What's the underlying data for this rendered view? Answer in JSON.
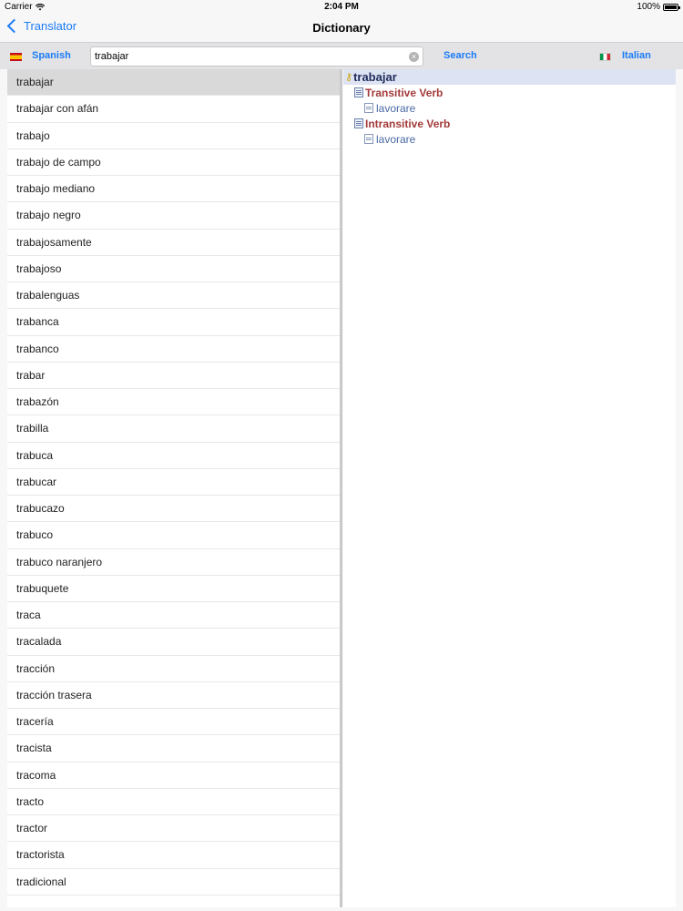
{
  "status_bar": {
    "carrier": "Carrier",
    "time": "2:04 PM",
    "battery": "100%"
  },
  "nav": {
    "back_label": "Translator",
    "title": "Dictionary"
  },
  "toolbar": {
    "source_language": "Spanish",
    "target_language": "Italian",
    "search_value": "trabajar",
    "search_button": "Search"
  },
  "word_list": [
    "trabajar",
    "trabajar con afán",
    "trabajo",
    "trabajo de campo",
    "trabajo mediano",
    "trabajo negro",
    "trabajosamente",
    "trabajoso",
    "trabalenguas",
    "trabanca",
    "trabanco",
    "trabar",
    "trabazón",
    "trabilla",
    "trabuca",
    "trabucar",
    "trabucazo",
    "trabuco",
    "trabuco naranjero",
    "trabuquete",
    "traca",
    "tracalada",
    "tracción",
    "tracción trasera",
    "tracería",
    "tracista",
    "tracoma",
    "tracto",
    "tractor",
    "tractorista",
    "tradicional"
  ],
  "selected_index": 0,
  "entry": {
    "word": "trabajar",
    "senses": [
      {
        "pos": "Transitive Verb",
        "translations": [
          "lavorare"
        ]
      },
      {
        "pos": "Intransitive Verb",
        "translations": [
          "lavorare"
        ]
      }
    ]
  }
}
